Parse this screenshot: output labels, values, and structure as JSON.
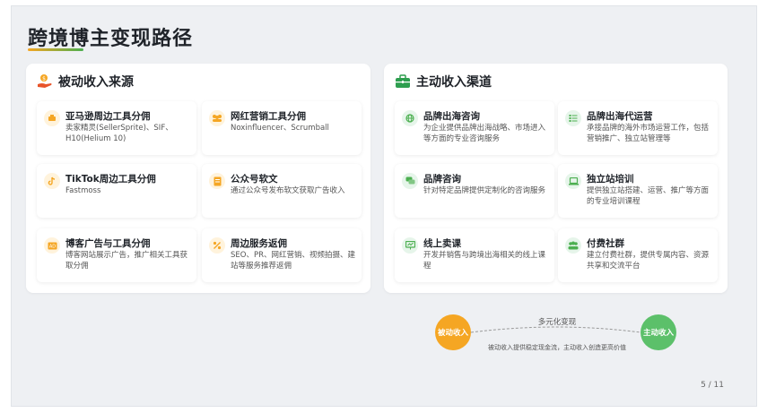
{
  "page": {
    "title": "跨境博主变现路径",
    "page_number": "5 / 11"
  },
  "passive": {
    "title": "被动收入来源",
    "icon": "hand-coin-icon",
    "cards": [
      {
        "title": "亚马逊周边工具分佣",
        "desc": "卖家精灵(SellerSprite)、SIF、H10(Helium 10)",
        "icon": "cart-icon"
      },
      {
        "title": "网红营销工具分佣",
        "desc": "Noxinfluencer、Scrumball",
        "icon": "people-icon"
      },
      {
        "title": "TikTok周边工具分佣",
        "desc": "Fastmoss",
        "icon": "tiktok-icon"
      },
      {
        "title": "公众号软文",
        "desc": "通过公众号发布软文获取广告收入",
        "icon": "document-icon"
      },
      {
        "title": "博客广告与工具分佣",
        "desc": "博客网站展示广告，推广相关工具获取分佣",
        "icon": "ad-icon"
      },
      {
        "title": "周边服务返佣",
        "desc": "SEO、PR、网红营销、视频拍摄、建站等服务推荐返佣",
        "icon": "percent-icon"
      }
    ]
  },
  "active": {
    "title": "主动收入渠道",
    "icon": "briefcase-icon",
    "cards": [
      {
        "title": "品牌出海咨询",
        "desc": "为企业提供品牌出海战略、市场进入等方面的专业咨询服务",
        "icon": "globe-icon"
      },
      {
        "title": "品牌出海代运营",
        "desc": "承接品牌的海外市场运营工作，包括营销推广、独立站管理等",
        "icon": "list-icon"
      },
      {
        "title": "品牌咨询",
        "desc": "针对特定品牌提供定制化的咨询服务",
        "icon": "chat-icon"
      },
      {
        "title": "独立站培训",
        "desc": "提供独立站搭建、运营、推广等方面的专业培训课程",
        "icon": "laptop-icon"
      },
      {
        "title": "线上卖课",
        "desc": "开发并销售与跨境出海相关的线上课程",
        "icon": "presentation-icon"
      },
      {
        "title": "付费社群",
        "desc": "建立付费社群，提供专属内容、资源共享和交流平台",
        "icon": "group-icon"
      }
    ]
  },
  "flow": {
    "left_label": "被动收入",
    "right_label": "主动收入",
    "top_text": "多元化变现",
    "bottom_text": "被动收入提供稳定现金流，主动收入创造更高价值"
  },
  "colors": {
    "passive_accent": "#f5a623",
    "active_accent": "#4caf50"
  }
}
